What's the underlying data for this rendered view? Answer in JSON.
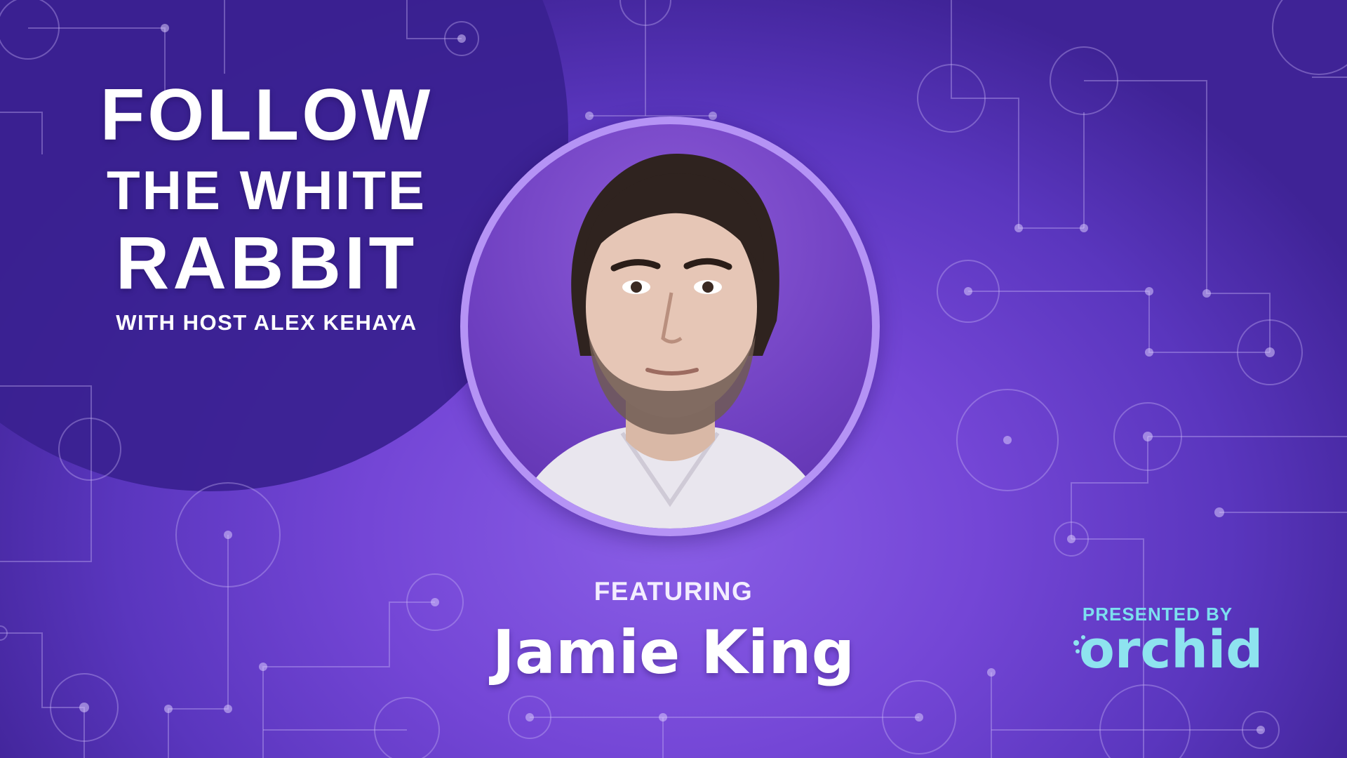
{
  "title": {
    "line1": "FOLLOW",
    "line2": "THE WHITE",
    "line3": "RABBIT",
    "host": "WITH HOST ALEX KEHAYA"
  },
  "guest": {
    "label": "FEATURING",
    "name": "Jamie King"
  },
  "sponsor": {
    "label": "PRESENTED BY",
    "name": "orchid"
  },
  "colors": {
    "background": "#7446d6",
    "dark_circle": "#3a2190",
    "ring": "#b593f5",
    "accent": "#7ce0ef"
  },
  "icons": {
    "portrait": "person-photo",
    "logo": "orchid-logo"
  }
}
